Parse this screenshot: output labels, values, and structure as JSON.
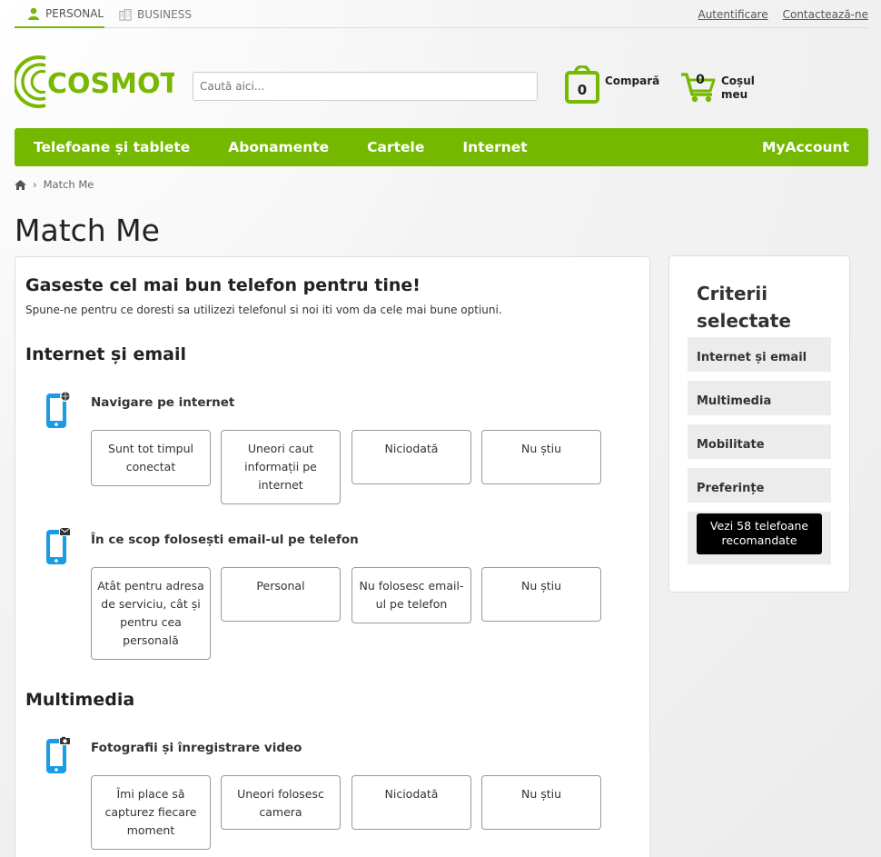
{
  "topbar": {
    "personal": "PERSONAL",
    "business": "BUSINESS",
    "login": "Autentificare",
    "contact": "Contactează-ne"
  },
  "logo": {
    "text": "COSMOTE",
    "color": "#77b800"
  },
  "search": {
    "placeholder": "Caută aici..."
  },
  "compare": {
    "count": "0",
    "label": "Compară"
  },
  "cart": {
    "count": "0",
    "label_line1": "Coșul",
    "label_line2": "meu"
  },
  "nav": {
    "items": [
      "Telefoane și tablete",
      "Abonamente",
      "Cartele",
      "Internet"
    ],
    "account": "MyAccount",
    "color": "#75b800"
  },
  "breadcrumb": {
    "current": "Match Me"
  },
  "page": {
    "title": "Match Me"
  },
  "main": {
    "headline": "Gaseste cel mai bun telefon pentru tine!",
    "subtitle": "Spune-ne pentru ce doresti sa utilizezi telefonul si noi iti vom da cele mai bune optiuni.",
    "sections": [
      {
        "title": "Internet și email",
        "questions": [
          {
            "icon": "phone-globe-icon",
            "label": "Navigare pe internet",
            "options": [
              "Sunt tot timpul conectat",
              "Uneori caut informații pe internet",
              "Niciodată",
              "Nu știu"
            ]
          },
          {
            "icon": "phone-email-icon",
            "label": "În ce scop folosești email-ul pe telefon",
            "options": [
              "Atât pentru adresa de serviciu, cât și pentru cea personală",
              "Personal",
              "Nu folosesc email-ul pe telefon",
              "Nu știu"
            ]
          }
        ]
      },
      {
        "title": "Multimedia",
        "questions": [
          {
            "icon": "phone-camera-icon",
            "label": "Fotografii și înregistrare video",
            "options": [
              "Îmi place să capturez fiecare moment",
              "Uneori folosesc camera",
              "Niciodată",
              "Nu știu"
            ]
          }
        ]
      }
    ]
  },
  "sidebar": {
    "title_line1": "Criterii",
    "title_line2": "selectate",
    "criteria": [
      "Internet și email",
      "Multimedia",
      "Mobilitate",
      "Preferințe"
    ],
    "cta": "Vezi 58 telefoane recomandate"
  }
}
